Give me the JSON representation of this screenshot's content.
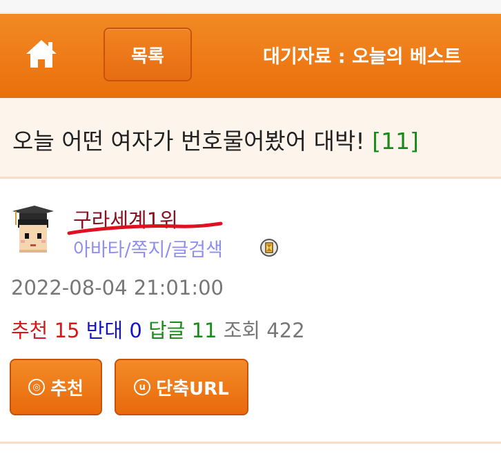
{
  "nav": {
    "home_icon": "home-icon",
    "list_label": "목록",
    "queue_text": "대기자료 : 오늘의 베스트"
  },
  "post": {
    "title": "오늘 어떤 여자가 번호물어봤어 대박!",
    "comment_count": "[11]"
  },
  "author": {
    "name": "구라세계1위",
    "links": "아바타/쪽지/글검색",
    "avatar_icon": "graduate-avatar-icon",
    "badge_icon": "hourglass-badge-icon"
  },
  "date": "2022-08-04 21:01:00",
  "stats": {
    "recommend_label": "추천",
    "recommend_value": "15",
    "oppose_label": "반대",
    "oppose_value": "0",
    "reply_label": "답글",
    "reply_value": "11",
    "view_label": "조회",
    "view_value": "422"
  },
  "buttons": {
    "recommend_icon_char": "◎",
    "recommend_label": "추천",
    "url_icon_char": "u",
    "url_label": "단축URL"
  },
  "colors": {
    "nav_orange": "#ee7c16",
    "title_bg": "#fdf4ec",
    "author_red": "#8b1020",
    "link_purple": "#8f8ff0",
    "recommend_red": "#d81818",
    "oppose_blue": "#1515c8",
    "reply_green": "#1a8a1a"
  }
}
